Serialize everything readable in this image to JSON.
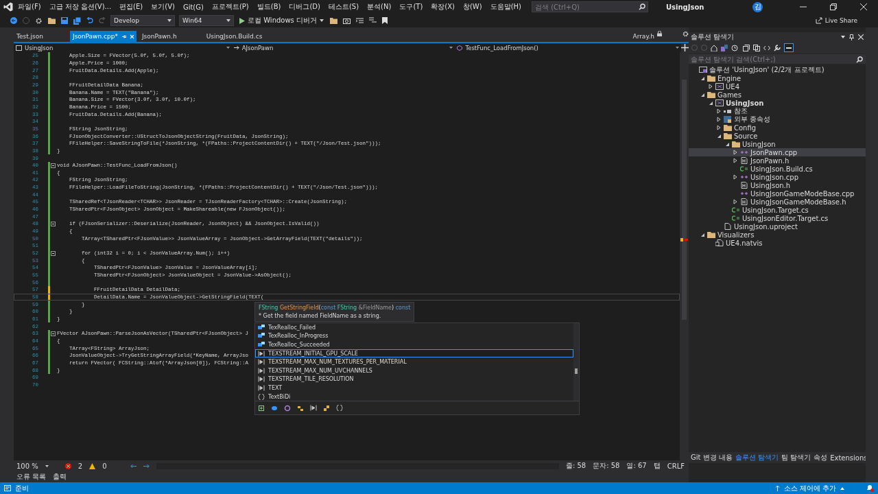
{
  "title_bar": {
    "menu": [
      "파일(F)",
      "고급 저장 옵션(V)...",
      "편집(E)",
      "보기(V)",
      "Git(G)",
      "프로젝트(P)",
      "빌드(B)",
      "디버그(D)",
      "테스트(S)",
      "분석(N)",
      "도구(T)",
      "확장(X)",
      "창(W)",
      "도움말(H)"
    ],
    "search": {
      "placeholder": "검색 (Ctrl+Q)"
    },
    "solution_name": "UsingJson",
    "avatar": "김"
  },
  "toolbar": {
    "configuration": "Develop",
    "platform": "Win64",
    "run_target": "로컬 Windows 디버거",
    "live_share": "Live Share"
  },
  "editor": {
    "tabs": [
      {
        "label": "Test.json",
        "selected": false
      },
      {
        "label": "JsonPawn.cpp*",
        "selected": true
      },
      {
        "label": "JsonPawn.h",
        "selected": false
      },
      {
        "label": "UsingJson.Build.cs",
        "selected": false
      }
    ],
    "preview_tab": "Array.h",
    "nav": {
      "project": "UsingJson",
      "class": "AJsonPawn",
      "member": "TestFunc_LoadFromJson()"
    },
    "lines": [
      {
        "n": "25",
        "code": "    Apple.Size = FVector(5.0f, 5.0f, 5.0f);",
        "kind": "saved",
        "foldable": false,
        "current": false
      },
      {
        "n": "26",
        "code": "    Apple.Price = 1000;",
        "kind": "saved",
        "foldable": false,
        "current": false
      },
      {
        "n": "27",
        "code": "    FruitData.Details.Add(Apple);",
        "kind": "saved",
        "foldable": false,
        "current": false
      },
      {
        "n": "28",
        "kind": "saved",
        "foldable": false,
        "current": false
      },
      {
        "n": "29",
        "code": "    FFruitDetailData Banana;",
        "kind": "saved",
        "foldable": false,
        "current": false
      },
      {
        "n": "30",
        "code": "    Banana.Name = TEXT(\"Banana\");",
        "kind": "saved",
        "foldable": false,
        "current": false
      },
      {
        "n": "31",
        "code": "    Banana.Size = FVector(3.0f, 3.0f, 10.0f);",
        "kind": "saved",
        "foldable": false,
        "current": false
      },
      {
        "n": "32",
        "code": "    Banana.Price = 1500;",
        "kind": "saved",
        "foldable": false,
        "current": false
      },
      {
        "n": "33",
        "code": "    FruitData.Details.Add(Banana);",
        "kind": "saved",
        "foldable": false,
        "current": false
      },
      {
        "n": "34",
        "kind": "saved",
        "foldable": false,
        "current": false
      },
      {
        "n": "35",
        "code": "    FString JsonString;",
        "kind": "saved",
        "foldable": false,
        "current": false
      },
      {
        "n": "36",
        "code": "    FJsonObjectConverter::UStructToJsonObjectString(FruitData, JsonString);",
        "kind": "saved",
        "foldable": false,
        "current": false
      },
      {
        "n": "37",
        "code": "    FFileHelper::SaveStringToFile(*JsonString, *(FPaths::ProjectContentDir() + TEXT(\"/Json/Test.json\")));",
        "kind": "saved",
        "foldable": false,
        "current": false
      },
      {
        "n": "38",
        "code": "}",
        "kind": "saved",
        "foldable": false,
        "current": false
      },
      {
        "n": "39",
        "kind": "none",
        "foldable": false,
        "current": false
      },
      {
        "n": "40",
        "code": "void AJsonPawn::TestFunc_LoadFromJson()",
        "kind": "saved",
        "foldable": true,
        "current": false
      },
      {
        "n": "41",
        "code": "{",
        "kind": "saved",
        "foldable": false,
        "current": false
      },
      {
        "n": "42",
        "code": "    FString JsonString;",
        "kind": "saved",
        "foldable": false,
        "current": false
      },
      {
        "n": "43",
        "code": "    FFileHelper::LoadFileToString(JsonString, *(FPaths::ProjectContentDir() + TEXT(\"/Json/Test.json\")));",
        "kind": "saved",
        "foldable": false,
        "current": false
      },
      {
        "n": "44",
        "kind": "saved",
        "foldable": false,
        "current": false
      },
      {
        "n": "45",
        "code": "    TSharedRef<TJsonReader<TCHAR>> JsonReader = TJsonReaderFactory<TCHAR>::Create(JsonString);",
        "kind": "saved",
        "foldable": false,
        "current": false
      },
      {
        "n": "46",
        "code": "    TSharedPtr<FJsonObject> JsonObject = MakeShareable(new FJsonObject());",
        "kind": "saved",
        "foldable": false,
        "current": false
      },
      {
        "n": "47",
        "kind": "saved",
        "foldable": false,
        "current": false
      },
      {
        "n": "48",
        "code": "    if (FJsonSerializer::Deserialize(JsonReader, JsonObject) && JsonObject.IsValid())",
        "kind": "saved",
        "foldable": true,
        "current": false
      },
      {
        "n": "49",
        "code": "    {",
        "kind": "saved",
        "foldable": false,
        "current": false
      },
      {
        "n": "50",
        "code": "        TArray<TSharedPtr<FJsonValue>> JsonValueArray = JsonObject->GetArrayField(TEXT(\"details\"));",
        "kind": "saved",
        "foldable": false,
        "current": false
      },
      {
        "n": "51",
        "kind": "saved",
        "foldable": false,
        "current": false
      },
      {
        "n": "52",
        "code": "        for (int32 i = 0; i < JsonValueArray.Num(); i++)",
        "kind": "saved",
        "foldable": true,
        "current": false
      },
      {
        "n": "53",
        "code": "        {",
        "kind": "saved",
        "foldable": false,
        "current": false
      },
      {
        "n": "54",
        "code": "            TSharedPtr<FJsonValue> JsonValue = JsonValueArray[i];",
        "kind": "saved",
        "foldable": false,
        "current": false
      },
      {
        "n": "55",
        "code": "            TSharedPtr<FJsonObject> JsonValueObject = JsonValue->AsObject();",
        "kind": "saved",
        "foldable": false,
        "current": false
      },
      {
        "n": "56",
        "kind": "saved",
        "foldable": false,
        "current": false
      },
      {
        "n": "57",
        "code": "            FFruitDetailData DetailData;",
        "kind": "unsaved",
        "foldable": false,
        "current": false
      },
      {
        "n": "58",
        "code": "            DetailData.Name = JsonValueObject->GetStringField(TEXT(",
        "kind": "unsaved",
        "foldable": false,
        "current": true
      },
      {
        "n": "59",
        "code": "        }",
        "kind": "saved",
        "foldable": false,
        "current": false
      },
      {
        "n": "60",
        "code": "    }",
        "kind": "saved",
        "foldable": false,
        "current": false
      },
      {
        "n": "61",
        "code": "}",
        "kind": "saved",
        "foldable": false,
        "current": false
      },
      {
        "n": "62",
        "kind": "none",
        "foldable": false,
        "current": false
      },
      {
        "n": "63",
        "code": "FVector AJsonPawn::ParseJsonAsVector(TSharedPtr<FJsonObject> J",
        "kind": "saved",
        "foldable": true,
        "current": false
      },
      {
        "n": "64",
        "code": "{",
        "kind": "saved",
        "foldable": false,
        "current": false
      },
      {
        "n": "65",
        "code": "    TArray<FString> ArrayJson;",
        "kind": "saved",
        "foldable": false,
        "current": false
      },
      {
        "n": "66",
        "code": "    JsonValueObject->TryGetStringArrayField(*KeyName, ArrayJso",
        "kind": "saved",
        "foldable": false,
        "current": false
      },
      {
        "n": "67",
        "code": "    return FVector( FCString::Atof(*ArrayJson[0]), FCString::A",
        "kind": "saved",
        "foldable": false,
        "current": false
      },
      {
        "n": "68",
        "code": "}",
        "kind": "saved",
        "foldable": false,
        "current": false
      },
      {
        "n": "69",
        "kind": "none",
        "foldable": false,
        "current": false
      },
      {
        "n": "70",
        "kind": "none",
        "foldable": false,
        "current": false
      }
    ],
    "tooltip": {
      "signature": [
        {
          "text": "FString ",
          "kind": "type"
        },
        {
          "text": "GetStringField",
          "kind": "function"
        },
        {
          "text": "(",
          "kind": "punct"
        },
        {
          "text": "const ",
          "kind": "keyword"
        },
        {
          "text": "FString ",
          "kind": "struct"
        },
        {
          "text": "&FieldName",
          "kind": "param"
        },
        {
          "text": ") ",
          "kind": "punct"
        },
        {
          "text": "const",
          "kind": "keyword"
        }
      ],
      "description": "* Get the field named FieldName as a string."
    },
    "completion": [
      {
        "label": "TexRealloc_Failed",
        "kind": "enum",
        "selected": false
      },
      {
        "label": "TexRealloc_InProgress",
        "kind": "enum",
        "selected": false
      },
      {
        "label": "TexRealloc_Succeeded",
        "kind": "enum",
        "selected": false
      },
      {
        "label": "TEXSTREAM_INITIAL_GPU_SCALE",
        "kind": "macro",
        "selected": true
      },
      {
        "label": "TEXSTREAM_MAX_NUM_TEXTURES_PER_MATERIAL",
        "kind": "macro",
        "selected": false
      },
      {
        "label": "TEXSTREAM_MAX_NUM_UVCHANNELS",
        "kind": "macro",
        "selected": false
      },
      {
        "label": "TEXSTREAM_TILE_RESOLUTION",
        "kind": "macro",
        "selected": false
      },
      {
        "label": "TEXT",
        "kind": "macro",
        "selected": false
      },
      {
        "label": "TextBiDi",
        "kind": "namespace",
        "selected": false
      }
    ],
    "status": {
      "zoom": "100 %",
      "errors": "2",
      "warnings": "0",
      "line": "줄: 58",
      "char": "문자: 58",
      "col": "열: 67",
      "indent": "탭",
      "eol": "CRLF"
    }
  },
  "bottom_tabs": [
    "오류 목록",
    "출력"
  ],
  "solution_explorer": {
    "title": "솔루션 탐색기",
    "search": {
      "placeholder": "솔루션 탐색기 검색(Ctrl+;)"
    },
    "tree": [
      {
        "label": "솔루션 'UsingJson' (2/2개 프로젝트)",
        "kind": "solution",
        "selected": false,
        "children": [
          {
            "label": "Engine",
            "kind": "folder",
            "expanded": true,
            "selected": false,
            "children": [
              {
                "label": "UE4",
                "kind": "project",
                "expanded": false,
                "selected": false
              }
            ]
          },
          {
            "label": "Games",
            "kind": "folder",
            "expanded": true,
            "selected": false,
            "children": [
              {
                "label": "UsingJson",
                "kind": "project",
                "expanded": true,
                "bold": true,
                "selected": false,
                "children": [
                  {
                    "label": "참조",
                    "kind": "references",
                    "expanded": false,
                    "selected": false
                  },
                  {
                    "label": "외부 종속성",
                    "kind": "dependencies",
                    "expanded": false,
                    "selected": false
                  },
                  {
                    "label": "Config",
                    "kind": "folder",
                    "expanded": false,
                    "selected": false
                  },
                  {
                    "label": "Source",
                    "kind": "folder",
                    "expanded": true,
                    "selected": false,
                    "children": [
                      {
                        "label": "UsingJson",
                        "kind": "folder",
                        "expanded": true,
                        "selected": false,
                        "children": [
                          {
                            "label": "JsonPawn.cpp",
                            "kind": "cpp",
                            "expanded": false,
                            "selected": true
                          },
                          {
                            "label": "JsonPawn.h",
                            "kind": "header",
                            "expanded": false,
                            "selected": false
                          },
                          {
                            "label": "UsingJson.Build.cs",
                            "kind": "csharp",
                            "selected": false
                          },
                          {
                            "label": "UsingJson.cpp",
                            "kind": "cpp",
                            "expanded": false,
                            "selected": false
                          },
                          {
                            "label": "UsingJson.h",
                            "kind": "header",
                            "selected": false
                          },
                          {
                            "label": "UsingJsonGameModeBase.cpp",
                            "kind": "cpp",
                            "selected": false
                          },
                          {
                            "label": "UsingJsonGameModeBase.h",
                            "kind": "header",
                            "expanded": false,
                            "selected": false
                          }
                        ]
                      },
                      {
                        "label": "UsingJson.Target.cs",
                        "kind": "csharp",
                        "selected": false
                      },
                      {
                        "label": "UsingJsonEditor.Target.cs",
                        "kind": "csharp",
                        "selected": false
                      }
                    ]
                  },
                  {
                    "label": "UsingJson.uproject",
                    "kind": "file",
                    "selected": false
                  }
                ]
              }
            ]
          },
          {
            "label": "Visualizers",
            "kind": "folder",
            "expanded": true,
            "selected": false,
            "children": [
              {
                "label": "UE4.natvis",
                "kind": "natvis",
                "selected": false
              }
            ]
          }
        ]
      }
    ]
  },
  "side_tabs": [
    {
      "label": "Git 변경 내용",
      "selected": false
    },
    {
      "label": "솔루션 탐색기",
      "selected": true
    },
    {
      "label": "팀 탐색기",
      "selected": false
    },
    {
      "label": "속성",
      "selected": false
    },
    {
      "label": "Extensions",
      "selected": false
    }
  ],
  "status_bar": {
    "message": "준비",
    "source_control": "소스 제어에 추가"
  }
}
